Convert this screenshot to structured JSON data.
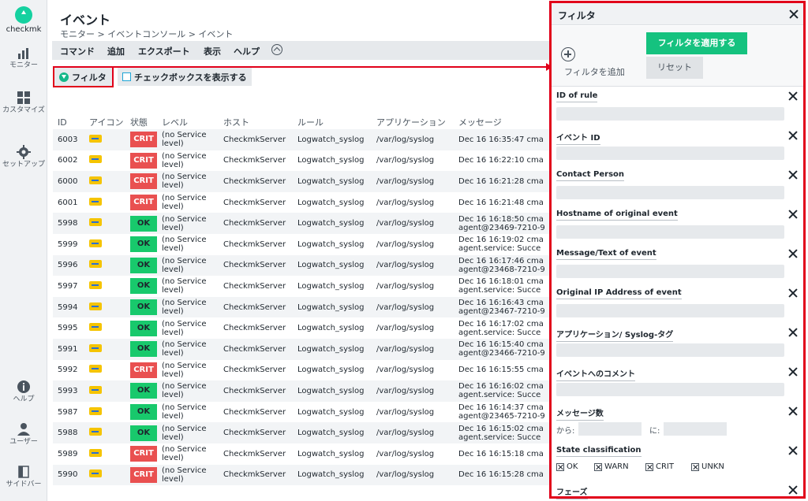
{
  "nav": {
    "logo": "checkmk",
    "monitor": "モニター",
    "customize": "カスタマイズ",
    "setup": "セットアップ",
    "help": "ヘルプ",
    "user": "ユーザー",
    "sidebar": "サイドバー"
  },
  "page": {
    "title": "イベント",
    "breadcrumb": "モニター > イベントコンソール > イベント"
  },
  "menu": {
    "command": "コマンド",
    "add": "追加",
    "export": "エクスポート",
    "view": "表示",
    "help": "ヘルプ"
  },
  "toolbar": {
    "filter": "フィルタ",
    "show_checkboxes": "チェックボックスを表示する"
  },
  "table": {
    "headers": [
      "ID",
      "アイコン",
      "状態",
      "レベル",
      "ホスト",
      "ルール",
      "アプリケーション",
      "メッセージ"
    ],
    "rows": [
      {
        "id": "6003",
        "state": "CRIT",
        "level1": "(no Service",
        "level2": "level)",
        "host": "CheckmkServer",
        "rule": "Logwatch_syslog",
        "app": "/var/log/syslog",
        "msg1": "Dec 16 16:35:47 cma",
        "msg2": ""
      },
      {
        "id": "6002",
        "state": "CRIT",
        "level1": "(no Service",
        "level2": "level)",
        "host": "CheckmkServer",
        "rule": "Logwatch_syslog",
        "app": "/var/log/syslog",
        "msg1": "Dec 16 16:22:10 cma",
        "msg2": ""
      },
      {
        "id": "6000",
        "state": "CRIT",
        "level1": "(no Service",
        "level2": "level)",
        "host": "CheckmkServer",
        "rule": "Logwatch_syslog",
        "app": "/var/log/syslog",
        "msg1": "Dec 16 16:21:28 cma",
        "msg2": ""
      },
      {
        "id": "6001",
        "state": "CRIT",
        "level1": "(no Service",
        "level2": "level)",
        "host": "CheckmkServer",
        "rule": "Logwatch_syslog",
        "app": "/var/log/syslog",
        "msg1": "Dec 16 16:21:48 cma",
        "msg2": ""
      },
      {
        "id": "5998",
        "state": "OK",
        "level1": "(no Service",
        "level2": "level)",
        "host": "CheckmkServer",
        "rule": "Logwatch_syslog",
        "app": "/var/log/syslog",
        "msg1": "Dec 16 16:18:50 cma",
        "msg2": "agent@23469-7210-9"
      },
      {
        "id": "5999",
        "state": "OK",
        "level1": "(no Service",
        "level2": "level)",
        "host": "CheckmkServer",
        "rule": "Logwatch_syslog",
        "app": "/var/log/syslog",
        "msg1": "Dec 16 16:19:02 cma",
        "msg2": "agent.service: Succe"
      },
      {
        "id": "5996",
        "state": "OK",
        "level1": "(no Service",
        "level2": "level)",
        "host": "CheckmkServer",
        "rule": "Logwatch_syslog",
        "app": "/var/log/syslog",
        "msg1": "Dec 16 16:17:46 cma",
        "msg2": "agent@23468-7210-9"
      },
      {
        "id": "5997",
        "state": "OK",
        "level1": "(no Service",
        "level2": "level)",
        "host": "CheckmkServer",
        "rule": "Logwatch_syslog",
        "app": "/var/log/syslog",
        "msg1": "Dec 16 16:18:01 cma",
        "msg2": "agent.service: Succe"
      },
      {
        "id": "5994",
        "state": "OK",
        "level1": "(no Service",
        "level2": "level)",
        "host": "CheckmkServer",
        "rule": "Logwatch_syslog",
        "app": "/var/log/syslog",
        "msg1": "Dec 16 16:16:43 cma",
        "msg2": "agent@23467-7210-9"
      },
      {
        "id": "5995",
        "state": "OK",
        "level1": "(no Service",
        "level2": "level)",
        "host": "CheckmkServer",
        "rule": "Logwatch_syslog",
        "app": "/var/log/syslog",
        "msg1": "Dec 16 16:17:02 cma",
        "msg2": "agent.service: Succe"
      },
      {
        "id": "5991",
        "state": "OK",
        "level1": "(no Service",
        "level2": "level)",
        "host": "CheckmkServer",
        "rule": "Logwatch_syslog",
        "app": "/var/log/syslog",
        "msg1": "Dec 16 16:15:40 cma",
        "msg2": "agent@23466-7210-9"
      },
      {
        "id": "5992",
        "state": "CRIT",
        "level1": "(no Service",
        "level2": "level)",
        "host": "CheckmkServer",
        "rule": "Logwatch_syslog",
        "app": "/var/log/syslog",
        "msg1": "Dec 16 16:15:55 cma",
        "msg2": ""
      },
      {
        "id": "5993",
        "state": "OK",
        "level1": "(no Service",
        "level2": "level)",
        "host": "CheckmkServer",
        "rule": "Logwatch_syslog",
        "app": "/var/log/syslog",
        "msg1": "Dec 16 16:16:02 cma",
        "msg2": "agent.service: Succe"
      },
      {
        "id": "5987",
        "state": "OK",
        "level1": "(no Service",
        "level2": "level)",
        "host": "CheckmkServer",
        "rule": "Logwatch_syslog",
        "app": "/var/log/syslog",
        "msg1": "Dec 16 16:14:37 cma",
        "msg2": "agent@23465-7210-9"
      },
      {
        "id": "5988",
        "state": "OK",
        "level1": "(no Service",
        "level2": "level)",
        "host": "CheckmkServer",
        "rule": "Logwatch_syslog",
        "app": "/var/log/syslog",
        "msg1": "Dec 16 16:15:02 cma",
        "msg2": "agent.service: Succe"
      },
      {
        "id": "5989",
        "state": "CRIT",
        "level1": "(no Service",
        "level2": "level)",
        "host": "CheckmkServer",
        "rule": "Logwatch_syslog",
        "app": "/var/log/syslog",
        "msg1": "Dec 16 16:15:18 cma",
        "msg2": ""
      },
      {
        "id": "5990",
        "state": "CRIT",
        "level1": "(no Service",
        "level2": "level)",
        "host": "CheckmkServer",
        "rule": "Logwatch_syslog",
        "app": "/var/log/syslog",
        "msg1": "Dec 16 16:15:28 cma",
        "msg2": ""
      }
    ]
  },
  "filter_panel": {
    "title": "フィルタ",
    "add_filter": "フィルタを追加",
    "apply": "フィルタを適用する",
    "reset": "リセット",
    "filters": [
      {
        "label": "ID of rule",
        "kind": "text"
      },
      {
        "label": "イベント ID",
        "kind": "text"
      },
      {
        "label": "Contact Person",
        "kind": "text"
      },
      {
        "label": "Hostname of original event",
        "kind": "text"
      },
      {
        "label": "Message/Text of event",
        "kind": "text"
      },
      {
        "label": "Original IP Address of event",
        "kind": "text"
      },
      {
        "label": "アプリケーション/ Syslog-タグ",
        "kind": "text"
      },
      {
        "label": "イベントへのコメント",
        "kind": "text"
      }
    ],
    "count_filter": {
      "label": "メッセージ数",
      "from": "から:",
      "to": "に:"
    },
    "state_filter": {
      "label": "State classification",
      "options": [
        "OK",
        "WARN",
        "CRIT",
        "UNKN"
      ]
    },
    "phase_filter": {
      "label": "フェーズ"
    }
  },
  "colors": {
    "crit": "#e95050",
    "ok": "#18c96c",
    "highlight": "#e1001a",
    "apply": "#15c27f"
  }
}
